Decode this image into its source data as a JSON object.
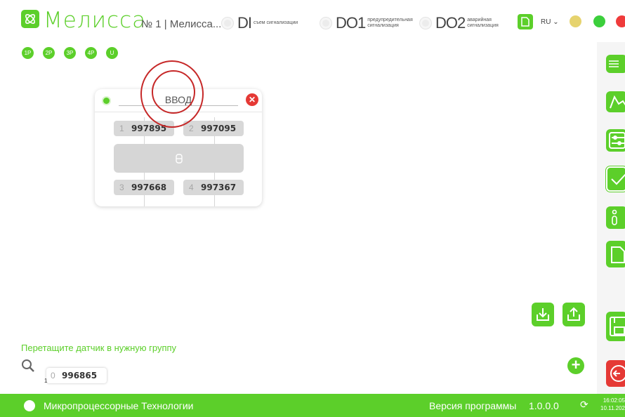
{
  "header": {
    "brand": "Мелисса",
    "device": "№ 1 | Мелисса...",
    "indicators": [
      {
        "code": "DI",
        "label": "съем сигнализации"
      },
      {
        "code": "DO1",
        "label": "предупредительная сигнализация"
      },
      {
        "code": "DO2",
        "label": "аварийная сигнализация"
      }
    ],
    "lang": "RU ⌄",
    "status_colors": [
      "#e6d36e",
      "#3ccf3c",
      "#ef3b3b"
    ]
  },
  "phases": [
    "1P",
    "2P",
    "3P",
    "4P",
    "U"
  ],
  "card": {
    "title": "ВВОД",
    "close": "✕",
    "sensors": [
      {
        "idx": "1",
        "id": "997895"
      },
      {
        "idx": "2",
        "id": "997095"
      },
      {
        "idx": "3",
        "id": "997668"
      },
      {
        "idx": "4",
        "id": "997367"
      }
    ]
  },
  "sidebar": {
    "buttons": [
      "list-icon",
      "chart-icon",
      "settings-sliders-icon",
      "check-icon",
      "info-icon",
      "file-icon",
      "save-icon",
      "logout-icon"
    ]
  },
  "hint": "Перетащите датчик в нужную группу",
  "free_sensor": {
    "sub": "1",
    "idx": "0",
    "id": "996865"
  },
  "add_label": "+",
  "footer": {
    "company": "Микропроцессорные Технологии",
    "version_label": "Версия программы",
    "version": "1.0.0.0",
    "time": "16:02:05",
    "date": "10.11.202"
  },
  "colors": {
    "accent": "#5ccf2a",
    "close": "#e53935"
  }
}
